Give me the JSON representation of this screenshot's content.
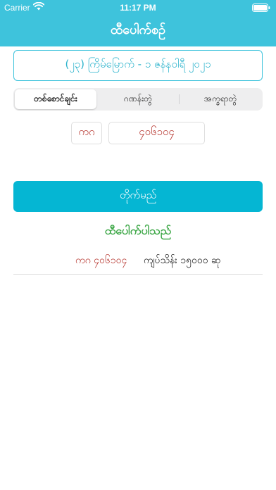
{
  "status_bar": {
    "carrier": "Carrier",
    "time": "11:17 PM"
  },
  "nav": {
    "title": "ထီပေါက်စဉ်"
  },
  "draw_date": {
    "label": "(၂၃) ကြိမ်မြောက် - ၁ ဇန်နဝါရီ ၂၀၂၁"
  },
  "segments": [
    {
      "label": "တစ်စောင်ချင်း",
      "selected": true
    },
    {
      "label": "ဂဏန်းတွဲ",
      "selected": false
    },
    {
      "label": "အက္ခရာတွဲ",
      "selected": false
    }
  ],
  "inputs": {
    "series_value": "ကဂ",
    "number_value": "၄၀၆၁၀၄"
  },
  "check_button": {
    "label": "တိုက်မည်"
  },
  "result": {
    "title": "ထီပေါက်ပါသည်",
    "ticket": "ကဂ ၄၀၆၁၀၄",
    "prize": "ကျပ်သိန်း ၁၅၀၀၀ ဆု"
  },
  "colors": {
    "header_bg": "#3ec3dc",
    "accent": "#05b6d3",
    "ticket_red": "#b5322b",
    "success_green": "#3aa644"
  },
  "icons": {
    "wifi": "wifi-icon",
    "battery": "battery-icon"
  }
}
